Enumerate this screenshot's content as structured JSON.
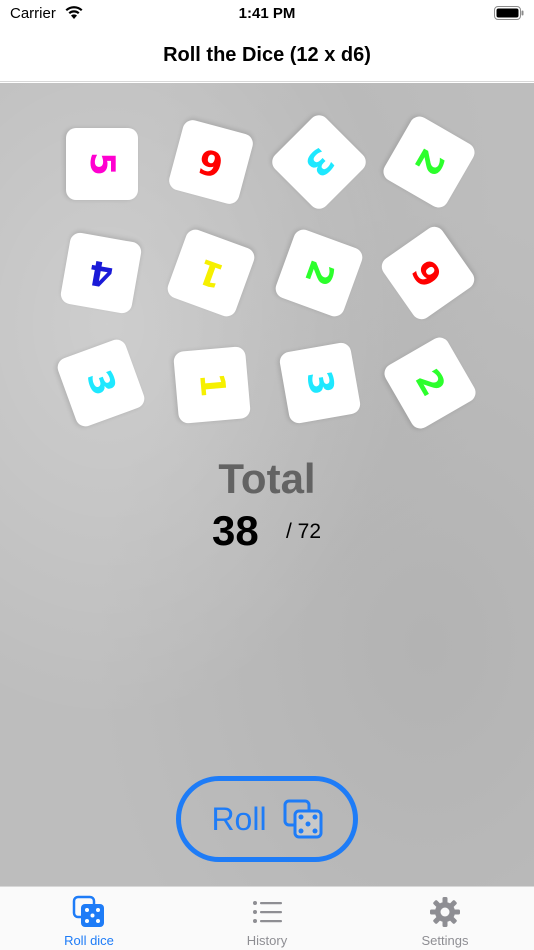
{
  "status_bar": {
    "carrier": "Carrier",
    "time": "1:41 PM"
  },
  "nav": {
    "title": "Roll the Dice (12 x d6)"
  },
  "dice": [
    {
      "value": "5",
      "color": "#ff00d0"
    },
    {
      "value": "6",
      "color": "#ff0000"
    },
    {
      "value": "3",
      "color": "#1ee8ff"
    },
    {
      "value": "2",
      "color": "#2cff2c"
    },
    {
      "value": "4",
      "color": "#1a1ad8"
    },
    {
      "value": "1",
      "color": "#f6f000"
    },
    {
      "value": "2",
      "color": "#2cff2c"
    },
    {
      "value": "6",
      "color": "#ff0000"
    },
    {
      "value": "3",
      "color": "#1ee8ff"
    },
    {
      "value": "1",
      "color": "#f6f000"
    },
    {
      "value": "3",
      "color": "#1ee8ff"
    },
    {
      "value": "2",
      "color": "#2cff2c"
    }
  ],
  "total": {
    "label": "Total",
    "value": "38",
    "max": "/ 72"
  },
  "roll_button": {
    "label": "Roll"
  },
  "tabs": [
    {
      "label": "Roll dice",
      "icon": "dice-icon",
      "active": true
    },
    {
      "label": "History",
      "icon": "list-icon",
      "active": false
    },
    {
      "label": "Settings",
      "icon": "gear-icon",
      "active": false
    }
  ],
  "colors": {
    "accent": "#1e7cf7",
    "inactive_tab": "#8e8e93",
    "total_label": "#636363"
  }
}
